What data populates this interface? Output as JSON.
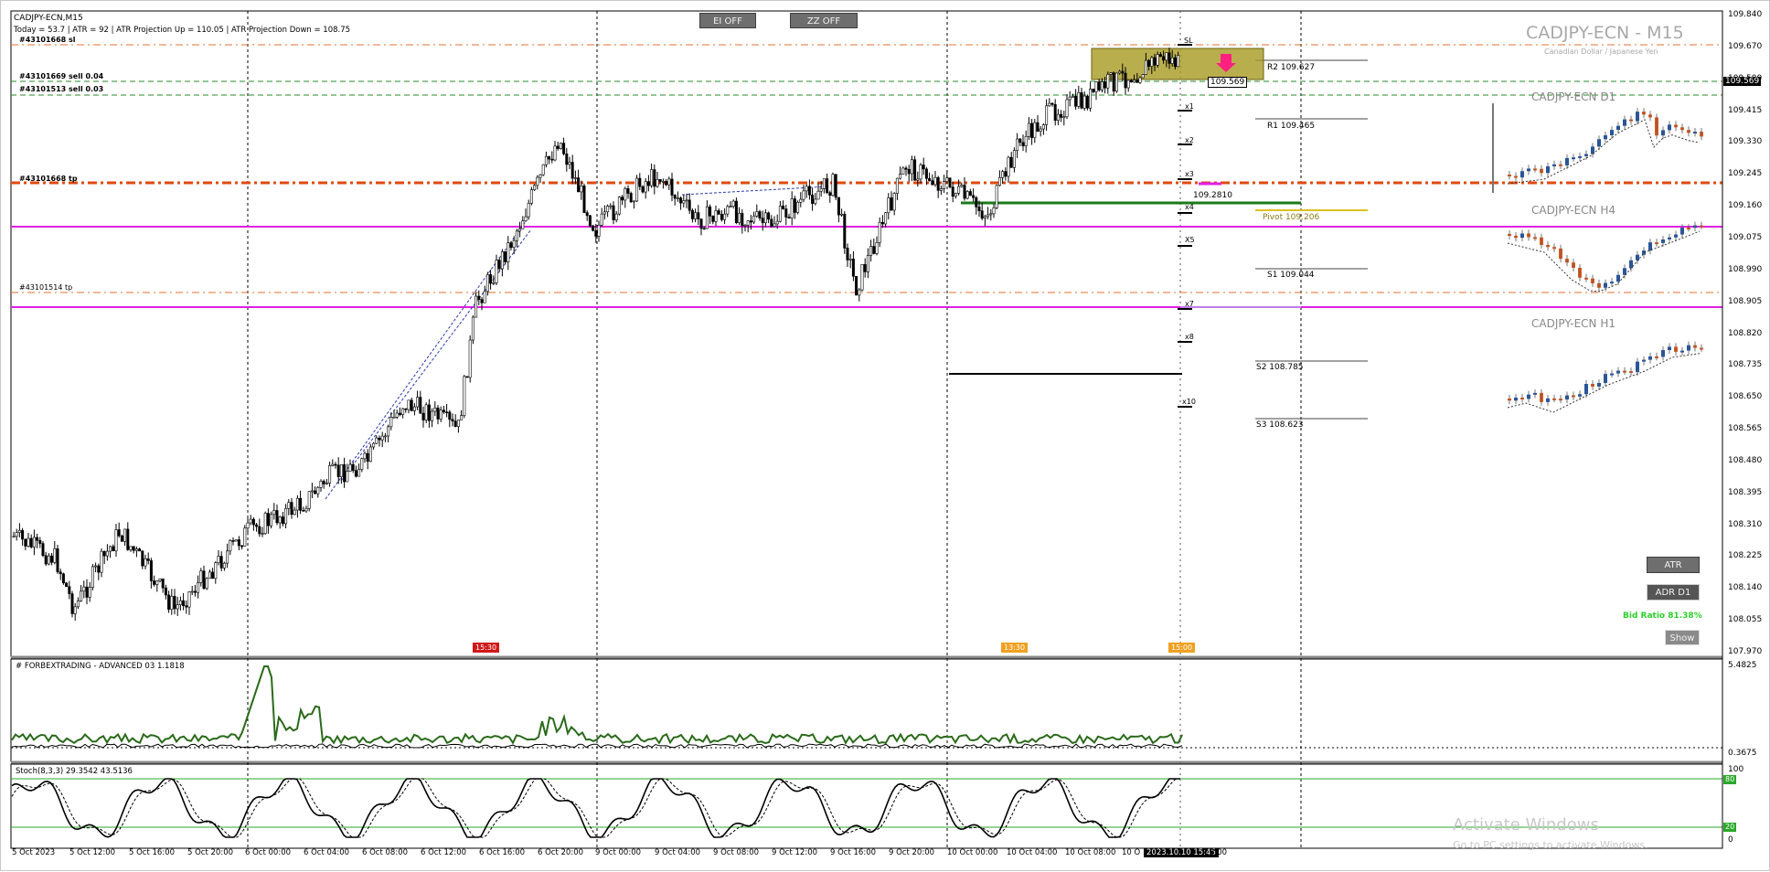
{
  "header": {
    "symbol": "CADJPY-ECN,M15",
    "today_line": "Today = 53.7   |   ATR = 92   |   ATR Projection Up = 110.05   |   ATR Projection Down = 108.75",
    "sl_label": "#43101668 sl",
    "sell1": "#43101669 sell 0.04",
    "sell2": "#43101513 sell 0.03",
    "tp_label1": "#43101668 tp",
    "tp_label2": "#43101514 tp"
  },
  "buttons": {
    "ei": "EI OFF",
    "zz": "ZZ OFF",
    "atr": "ATR",
    "adr": "ADR D1",
    "show": "Show"
  },
  "watermark": {
    "title": "CADJPY-ECN - M15",
    "subtitle": "Canadian Dollar / Japanese Yen"
  },
  "mini_charts": [
    {
      "title": "CADJPY-ECN D1"
    },
    {
      "title": "CADJPY-ECN H4"
    },
    {
      "title": "CADJPY-ECN H1"
    }
  ],
  "bid_ratio": "Bid Ratio 81.38%",
  "price_tag": "109.569",
  "levels": {
    "r2": "R2 109.627",
    "r1": "R1 109.465",
    "pivot": "Pivot 109.206",
    "s1": "S1 109.044",
    "s2": "S2 108.785",
    "s3": "S3 108.623",
    "mid": "109.2810"
  },
  "x_marks": [
    "SL",
    "x1",
    "x2",
    "x3",
    "x4",
    "X5",
    "x7",
    "x8",
    "x10"
  ],
  "price_axis": {
    "labels": [
      "109.840",
      "109.670",
      "109.500",
      "109.415",
      "109.330",
      "109.245",
      "109.160",
      "109.075",
      "108.990",
      "108.905",
      "108.820",
      "108.735",
      "108.650",
      "108.565",
      "108.480",
      "108.395",
      "108.310",
      "108.225",
      "108.140",
      "108.055",
      "107.970"
    ],
    "current": "109.569"
  },
  "indicator1": {
    "title": "# FORBEXTRADING - ADVANCED 03 1.1818",
    "top": "5.4825",
    "bottom": "0.3675"
  },
  "indicator2": {
    "title": "Stoch(8,3,3) 29.3542 43.5136",
    "top": "100",
    "level80": "80",
    "level20": "20",
    "bottom": "0"
  },
  "time_axis": [
    "5 Oct 2023",
    "5 Oct 12:00",
    "5 Oct 16:00",
    "5 Oct 20:00",
    "6 Oct 00:00",
    "6 Oct 04:00",
    "6 Oct 08:00",
    "6 Oct 12:00",
    "6 Oct 16:00",
    "6 Oct 20:00",
    "9 Oct 00:00",
    "9 Oct 04:00",
    "9 Oct 08:00",
    "9 Oct 12:00",
    "9 Oct 16:00",
    "9 Oct 20:00",
    "10 Oct 00:00",
    "10 Oct 04:00",
    "10 Oct 08:00",
    "10 O",
    "2023.10.10 15:45",
    "8:00"
  ],
  "event_tags": [
    "15:30",
    "13:30",
    "15:00"
  ],
  "activation": {
    "line1": "Activate Windows",
    "line2": "Go to PC settings to activate Windows."
  },
  "colors": {
    "magenta": "#e020e0",
    "orange": "#e04a10",
    "green": "#1a7a1a",
    "olive": "#a89a20",
    "bull": "#1f55a8",
    "bear": "#e25a1c"
  }
}
